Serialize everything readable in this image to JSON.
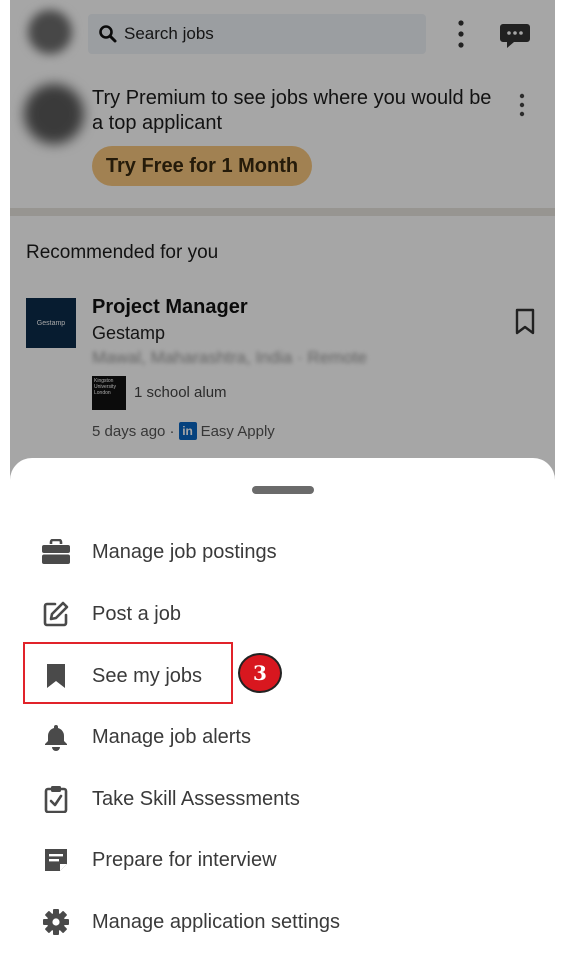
{
  "header": {
    "search_placeholder": "Search jobs"
  },
  "premium": {
    "text": "Try Premium to see jobs where you would be a top applicant",
    "button_label": "Try Free for 1 Month"
  },
  "recommended": {
    "title": "Recommended for you",
    "job": {
      "title": "Project Manager",
      "company": "Gestamp",
      "company_logo_text": "Gestamp",
      "location": "Mawal, Maharashtra, India · Remote",
      "alum_logo_text": "Kingston University London",
      "alum_text": "1 school alum",
      "posted": "5 days ago ·",
      "easy_apply": "Easy Apply",
      "linkedin_badge": "in"
    }
  },
  "sheet": {
    "items": [
      {
        "label": "Manage job postings",
        "icon": "briefcase-icon"
      },
      {
        "label": "Post a job",
        "icon": "edit-icon"
      },
      {
        "label": "See my jobs",
        "icon": "bookmark-icon"
      },
      {
        "label": "Manage job alerts",
        "icon": "bell-icon"
      },
      {
        "label": "Take Skill Assessments",
        "icon": "clipboard-check-icon"
      },
      {
        "label": "Prepare for interview",
        "icon": "note-icon"
      },
      {
        "label": "Manage application settings",
        "icon": "gear-icon"
      }
    ]
  },
  "annotation": {
    "step_number": "3",
    "highlight_color": "#e1232a"
  },
  "colors": {
    "premium_button": "#f8c77e",
    "linkedin_blue": "#0a66c2",
    "icon_gray": "#4a4a4a"
  }
}
